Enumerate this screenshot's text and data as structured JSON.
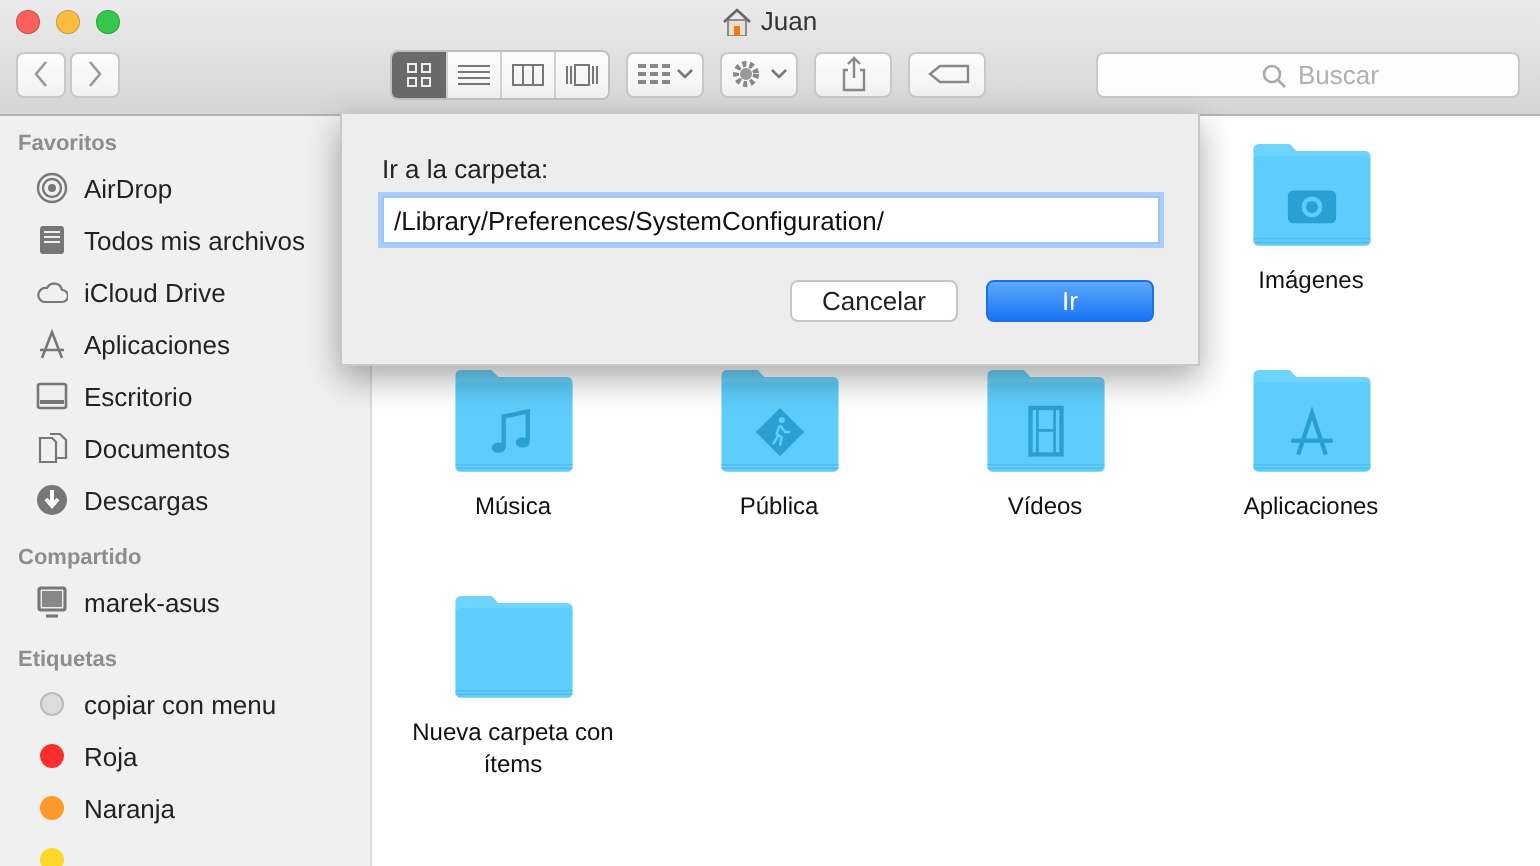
{
  "window": {
    "title": "Juan"
  },
  "toolbar": {
    "view_modes": [
      {
        "kind": "icons",
        "selected": true
      },
      {
        "kind": "list",
        "selected": false
      },
      {
        "kind": "columns",
        "selected": false
      },
      {
        "kind": "coverflow",
        "selected": false
      }
    ],
    "search": {
      "placeholder": "Buscar"
    }
  },
  "sidebar": {
    "sections": [
      {
        "title": "Favoritos",
        "items": [
          {
            "label": "AirDrop",
            "kind": "airdrop"
          },
          {
            "label": "Todos mis archivos",
            "kind": "files"
          },
          {
            "label": "iCloud Drive",
            "kind": "cloud"
          },
          {
            "label": "Aplicaciones",
            "kind": "apps"
          },
          {
            "label": "Escritorio",
            "kind": "desktop"
          },
          {
            "label": "Documentos",
            "kind": "docs"
          },
          {
            "label": "Descargas",
            "kind": "download"
          }
        ]
      },
      {
        "title": "Compartido",
        "items": [
          {
            "label": "marek-asus",
            "kind": "computer"
          }
        ]
      },
      {
        "title": "Etiquetas",
        "items": [
          {
            "label": "copiar con menu",
            "kind": "tag",
            "color": "#dddddd"
          },
          {
            "label": "Roja",
            "kind": "tag",
            "color": "#fc2d2d"
          },
          {
            "label": "Naranja",
            "kind": "tag",
            "color": "#fd9a2b"
          },
          {
            "kind": "tag",
            "color": "#fdd82b"
          }
        ]
      }
    ]
  },
  "folders": [
    {
      "label": "Imágenes",
      "kind": "camera"
    },
    {
      "label": "Música",
      "kind": "music"
    },
    {
      "label": "Pública",
      "kind": "public"
    },
    {
      "label": "Vídeos",
      "kind": "video"
    },
    {
      "label": "Aplicaciones",
      "kind": "apps"
    },
    {
      "label": "Nueva carpeta con ítems",
      "kind": "plain"
    }
  ],
  "dialog": {
    "label": "Ir a la carpeta:",
    "value": "/Library/Preferences/SystemConfiguration/",
    "buttons": [
      {
        "label": "Cancelar",
        "kind": "normal"
      },
      {
        "label": "Ir",
        "kind": "default"
      }
    ]
  }
}
